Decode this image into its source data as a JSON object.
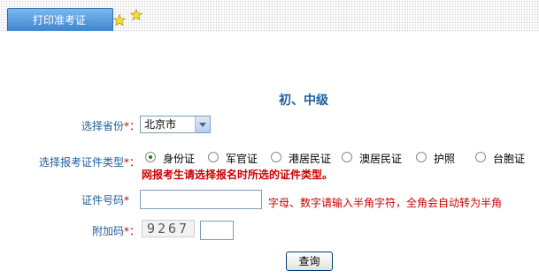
{
  "header": {
    "tab_label": "打印准考证",
    "icons": [
      "star-icon",
      "star-icon"
    ]
  },
  "section_title": "初、中级",
  "form": {
    "province": {
      "label": "选择省份",
      "required_mark": "*：",
      "selected_value": "北京市"
    },
    "id_type": {
      "label": "选择报考证件类型",
      "required_mark": "*：",
      "options": [
        "身份证",
        "军官证",
        "港居民证",
        "澳居民证",
        "护照",
        "台胞证"
      ],
      "selected_index": 0,
      "warning": "网报考生请选择报名时所选的证件类型。"
    },
    "id_number": {
      "label": "证件号码",
      "required_mark": "*",
      "value": "",
      "hint": "字母、数字请输入半角字符，全角会自动转为半角"
    },
    "captcha": {
      "label": "附加码",
      "required_mark": "*：",
      "code": "9267",
      "value": ""
    }
  },
  "submit_label": "查询",
  "colors": {
    "label": "#1a5e9e",
    "required": "#cc0000",
    "tab_bg": "#3d85cf"
  }
}
